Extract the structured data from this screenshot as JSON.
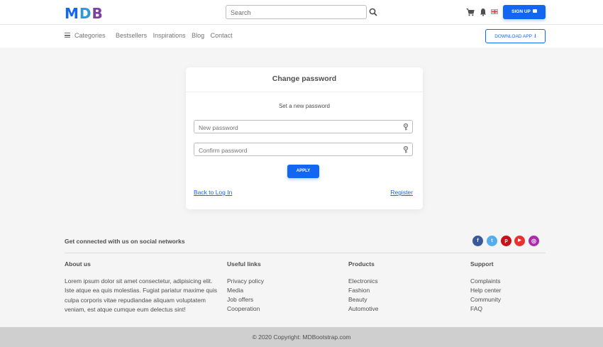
{
  "header": {
    "logo": {
      "m": "M",
      "d": "D",
      "b": "B"
    },
    "search_placeholder": "Search",
    "signup_label": "SIGN UP",
    "icons": [
      "search-icon",
      "cart-icon",
      "bell-icon",
      "flag-uk-icon",
      "lock-icon"
    ]
  },
  "nav": {
    "items": [
      "Categories",
      "Bestsellers",
      "Inspirations",
      "Blog",
      "Contact"
    ],
    "download_label": "DOWNLOAD APP"
  },
  "card": {
    "title": "Change password",
    "subtitle": "Set a new password",
    "new_password_placeholder": "New password",
    "confirm_password_placeholder": "Confirm password",
    "apply_label": "APPLY",
    "back_link": "Back to Log In",
    "register_link": "Register"
  },
  "footer": {
    "social_title": "Get connected with us on social networks",
    "social": [
      {
        "icon": "facebook-icon",
        "glyph": "f",
        "color": "#3b5998"
      },
      {
        "icon": "twitter-icon",
        "glyph": "t",
        "color": "#55acee"
      },
      {
        "icon": "pinterest-icon",
        "glyph": "p",
        "color": "#c61118"
      },
      {
        "icon": "youtube-icon",
        "glyph": "▶",
        "color": "#ed302f"
      },
      {
        "icon": "instagram-icon",
        "glyph": "◎",
        "color": "#ac2bac"
      }
    ],
    "about": {
      "title": "About us",
      "text": "Lorem ipsum dolor sit amet consectetur, adipisicing elit. Iste atque ea quis molestias. Fugiat pariatur maxime quis culpa corporis vitae repudiandae aliquam voluptatem veniam, est atque cumque eum delectus sint!"
    },
    "useful_links": {
      "title": "Useful links",
      "items": [
        "Privacy policy",
        "Media",
        "Job offers",
        "Cooperation"
      ]
    },
    "products": {
      "title": "Products",
      "items": [
        "Electronics",
        "Fashion",
        "Beauty",
        "Automotive"
      ]
    },
    "support": {
      "title": "Support",
      "items": [
        "Complaints",
        "Help center",
        "Community",
        "FAQ"
      ]
    },
    "copyright_prefix": "© 2020 Copyright:",
    "copyright_link": "MDBootstrap.com"
  },
  "colors": {
    "primary": "#1266f1",
    "background": "#f5f5f5",
    "bottombar": "#cfcfcf"
  }
}
